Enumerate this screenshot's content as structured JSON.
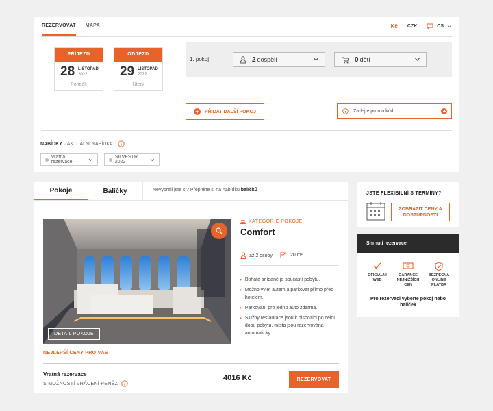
{
  "top_nav": {
    "tabs": [
      "REZERVOVAT",
      "MAPA"
    ],
    "currency_symbol": "Kč",
    "currency": "CZK",
    "language": "CS"
  },
  "dates": {
    "arrival": {
      "label": "PŘÍJEZD",
      "day": "28",
      "month": "LISTOPAD",
      "year": "2022",
      "weekday": "Pondělí"
    },
    "departure": {
      "label": "ODJEZD",
      "day": "29",
      "month": "LISTOPAD",
      "year": "2022",
      "weekday": "Úterý"
    }
  },
  "room_row": {
    "label": "1. pokoj",
    "adults_count": "2",
    "adults_label": "dospělí",
    "children_count": "0",
    "children_label": "dětí"
  },
  "add_room_label": "PŘIDAT DALŠÍ POKOJ",
  "promo_placeholder": "Zadejte promo kód",
  "offers": {
    "title": "NABÍDKY",
    "subtitle": "· AKTUÁLNÍ NABÍDKA",
    "chips": [
      "Vratná rezervace",
      "SILVESTR 2022"
    ]
  },
  "room_tabs": {
    "tabs": [
      "Pokoje",
      "Balíčky"
    ],
    "hint_prefix": "Nevybrali jste si? Přepněte si na nabídku ",
    "hint_link": "balíčků"
  },
  "room": {
    "category": "KATEGORIE POKOJE",
    "name": "Comfort",
    "guests": "až 2 osoby",
    "area": "20 m²",
    "detail_label": "DETAIL POKOJE",
    "features": [
      "Bohatá snídaně je součástí pobytu.",
      "Možno vyjet autem a parkovat přímo před hotelem.",
      "Parkování pro jedno auto zdarma.",
      "Služby restaurace jsou k dispozici po celou dobu pobytu, místa jsou rezervována automaticky."
    ],
    "best_price_label": "NEJLEPŠÍ CENY PRO VÁS",
    "rate_name": "Vratná rezervace",
    "rate_desc": "S MOŽNOSTÍ VRÁCENÍ PENĚZ",
    "price": "4016 Kč",
    "book_label": "REZERVOVAT"
  },
  "flexible": {
    "title": "JSTE FLEXIBILNÍ S TERMÍNY?",
    "button": "ZOBRAZIT CENY A DOSTUPNOSTI"
  },
  "summary": {
    "title": "Shrnutí rezervace",
    "features": [
      "OFICIÁLNÍ WEB",
      "GARANCE NEJNIŽŠÍCH CEN",
      "BEZPEČNÁ ONLINE PLATBA"
    ],
    "note": "Pro rezervaci vyberte pokoj nebo balíček"
  },
  "colors": {
    "accent": "#e8622a",
    "dark": "#2b2b2b"
  }
}
